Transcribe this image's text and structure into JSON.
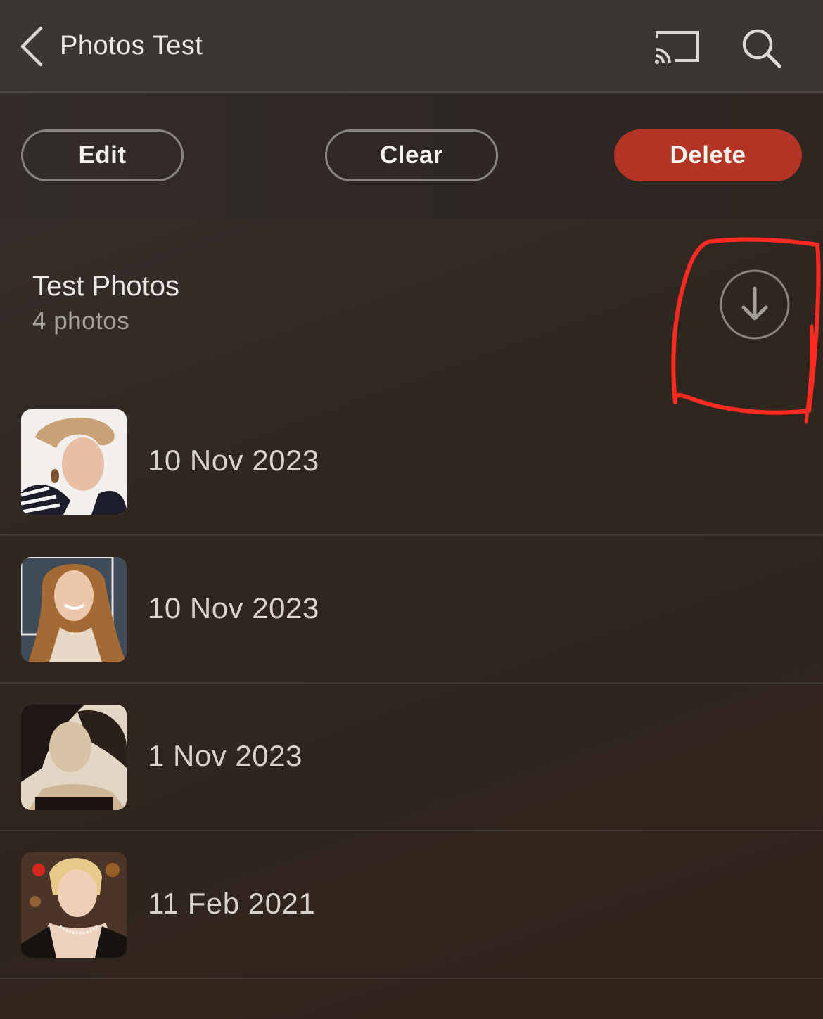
{
  "navbar": {
    "title": "Photos Test",
    "back_icon": "chevron-left-icon",
    "cast_icon": "cast-icon",
    "search_icon": "search-icon"
  },
  "toolbar": {
    "edit_label": "Edit",
    "clear_label": "Clear",
    "delete_label": "Delete",
    "delete_color": "#b33424"
  },
  "album": {
    "title": "Test Photos",
    "count": "4 photos",
    "download_icon": "download-arrow-icon"
  },
  "annotation_color": "#ff2a22",
  "photos": [
    {
      "date": "10 Nov 2023",
      "thumb_icon": "portrait-photo"
    },
    {
      "date": "10 Nov 2023",
      "thumb_icon": "portrait-photo"
    },
    {
      "date": "1 Nov 2023",
      "thumb_icon": "portrait-photo"
    },
    {
      "date": "11 Feb 2021",
      "thumb_icon": "portrait-photo"
    }
  ]
}
